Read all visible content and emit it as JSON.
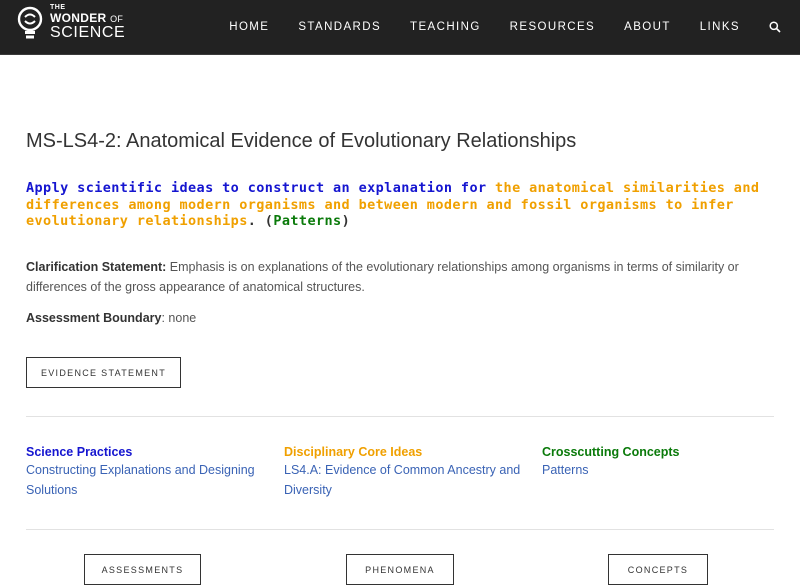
{
  "header": {
    "logo": {
      "the": "THE",
      "wonder": "WONDER",
      "of": "OF",
      "science": "SCIENCE"
    },
    "nav": [
      "HOME",
      "STANDARDS",
      "TEACHING",
      "RESOURCES",
      "ABOUT",
      "LINKS"
    ],
    "search_icon": "search-icon"
  },
  "standard": {
    "title": "MS-LS4-2: Anatomical Evidence of Evolutionary Relationships",
    "pe": {
      "practice": "Apply scientific ideas to construct an explanation for",
      "core": "the anatomical similarities and differences among modern organisms and between modern and fossil organisms to infer evolutionary relationships",
      "period": ".",
      "open": " (",
      "concept": "Patterns",
      "close": ")"
    },
    "clarification_label": "Clarification Statement:",
    "clarification_text": " Emphasis is on explanations of the evolutionary relationships among organisms in terms of similarity or differences of the gross appearance of anatomical structures.",
    "boundary_label": "Assessment Boundary",
    "boundary_text": ": none",
    "evidence_button": "EVIDENCE STATEMENT"
  },
  "dimensions": {
    "practices": {
      "heading": "Science Practices",
      "link": "Constructing Explanations and Designing Solutions"
    },
    "dci": {
      "heading": "Disciplinary Core Ideas",
      "link": "LS4.A: Evidence of Common Ancestry and Diversity"
    },
    "ccc": {
      "heading": "Crosscutting Concepts",
      "link": "Patterns"
    }
  },
  "bottom_buttons": [
    "ASSESSMENTS",
    "PHENOMENA",
    "CONCEPTS"
  ],
  "colors": {
    "practices": "#1515d0",
    "core_ideas": "#f0a000",
    "concepts": "#0a7a0a",
    "link": "#3a63b5",
    "header_bg": "#222222"
  }
}
